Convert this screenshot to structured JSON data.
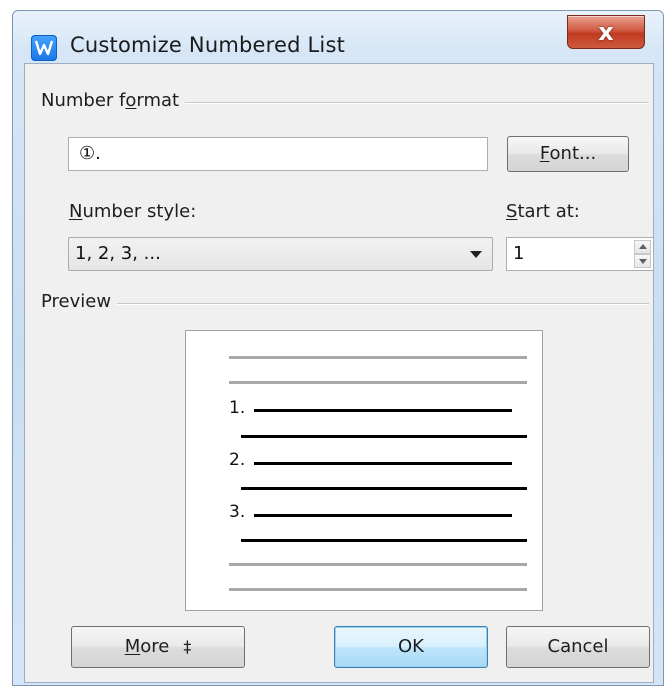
{
  "window": {
    "title": "Customize Numbered List",
    "close_label": "x"
  },
  "number_format": {
    "section_label_pre": "Number f",
    "section_label_key": "o",
    "section_label_post": "rmat",
    "value": "①."
  },
  "font_button": {
    "key": "F",
    "rest": "ont..."
  },
  "number_style": {
    "label_key": "N",
    "label_rest": "umber style:",
    "selected": "1, 2, 3, ..."
  },
  "start_at": {
    "label_key": "S",
    "label_rest": "tart at:",
    "value": "1"
  },
  "preview": {
    "section_label": "Preview",
    "numbers": [
      "1.",
      "2.",
      "3."
    ]
  },
  "buttons": {
    "more_key": "M",
    "more_rest": "ore",
    "more_icon": "‡",
    "ok": "OK",
    "cancel": "Cancel"
  },
  "colors": {
    "accent": "#3c7fb1",
    "close": "#c9482c"
  }
}
